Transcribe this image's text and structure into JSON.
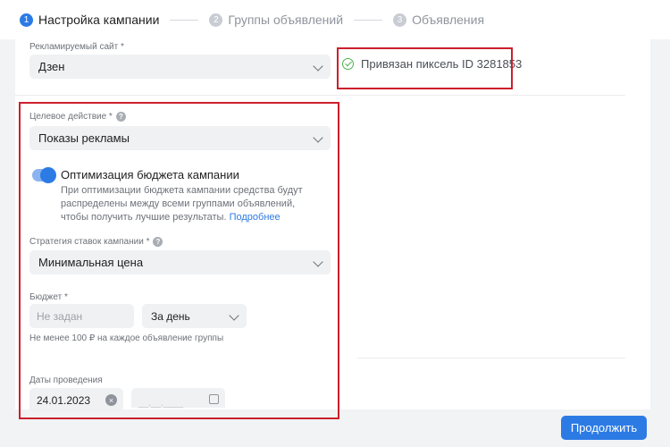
{
  "stepper": {
    "steps": [
      {
        "num": "1",
        "label": "Настройка кампании"
      },
      {
        "num": "2",
        "label": "Группы объявлений"
      },
      {
        "num": "3",
        "label": "Объявления"
      }
    ]
  },
  "site": {
    "label": "Рекламируемый сайт *",
    "value": "Дзен",
    "pixel_status": "Привязан пиксель ID 3281853"
  },
  "target_action": {
    "label": "Целевое действие *",
    "value": "Показы рекламы"
  },
  "budget_optimization": {
    "title": "Оптимизация бюджета кампании",
    "description": "При оптимизации бюджета кампании средства будут распределены между всеми группами объявлений, чтобы получить лучшие результаты.",
    "link": "Подробнее",
    "enabled": true
  },
  "bid_strategy": {
    "label": "Стратегия ставок кампании *",
    "value": "Минимальная цена"
  },
  "budget": {
    "label": "Бюджет *",
    "placeholder": "Не задан",
    "period": "За день",
    "hint": "Не менее 100 ₽ на каждое объявление группы"
  },
  "dates": {
    "label": "Даты проведения",
    "start": "24.01.2023",
    "end_placeholder": "__.__.____",
    "clear_glyph": "×"
  },
  "footer": {
    "continue_label": "Продолжить"
  },
  "colors": {
    "accent": "#2c7be5",
    "highlight": "#cc1f2c",
    "success": "#4bb34b"
  }
}
